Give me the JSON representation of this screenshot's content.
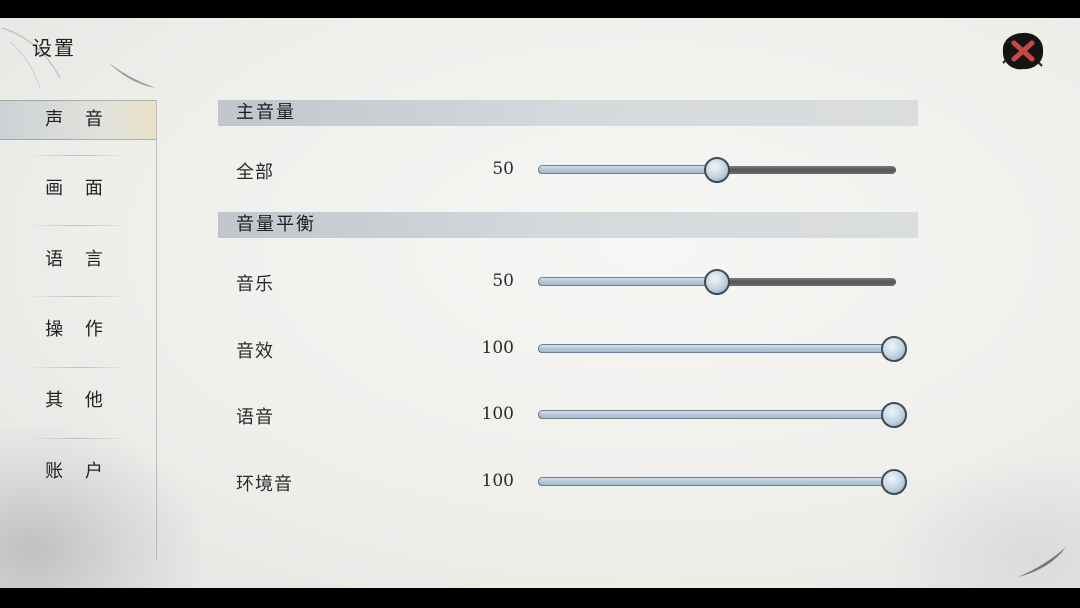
{
  "window": {
    "title": "设置"
  },
  "sidebar": {
    "items": [
      {
        "label": "声 音",
        "active": true
      },
      {
        "label": "画 面",
        "active": false
      },
      {
        "label": "语 言",
        "active": false
      },
      {
        "label": "操 作",
        "active": false
      },
      {
        "label": "其 他",
        "active": false
      },
      {
        "label": "账 户",
        "active": false
      }
    ]
  },
  "sections": {
    "master": {
      "title": "主音量"
    },
    "balance": {
      "title": "音量平衡"
    }
  },
  "settings": [
    {
      "label": "全部",
      "value": "50",
      "percent": 50,
      "max": 100
    },
    {
      "label": "音乐",
      "value": "50",
      "percent": 50,
      "max": 100
    },
    {
      "label": "音效",
      "value": "100",
      "percent": 100,
      "max": 100
    },
    {
      "label": "语音",
      "value": "100",
      "percent": 100,
      "max": 100
    },
    {
      "label": "环境音",
      "value": "100",
      "percent": 100,
      "max": 100
    }
  ],
  "icons": {
    "close": "close-icon",
    "accent_close": "#c84848"
  }
}
